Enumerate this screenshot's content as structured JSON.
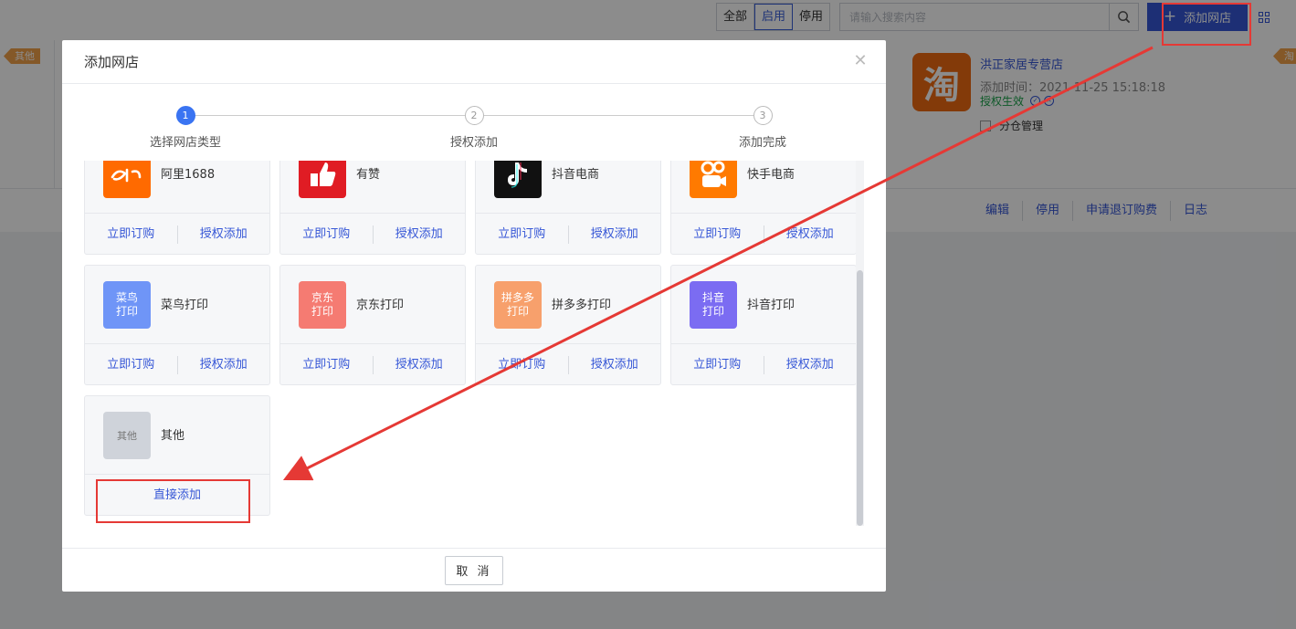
{
  "background": {
    "filters": [
      "全部",
      "启用",
      "停用"
    ],
    "active_filter": 1,
    "search_placeholder": "请输入搜索内容",
    "add_shop_label": "添加网店",
    "left_tag": "其他",
    "right_tag": "淘",
    "shop": {
      "logo_text": "淘",
      "name": "洪正家居专营店",
      "time": "添加时间：2021-11-25 15:18:18",
      "status": "授权生效",
      "checkbox_label": "分仓管理"
    },
    "actions": [
      "编辑",
      "停用",
      "申请退订购费",
      "日志"
    ]
  },
  "modal": {
    "title": "添加网店",
    "steps": [
      {
        "num": "1",
        "label": "选择网店类型"
      },
      {
        "num": "2",
        "label": "授权添加"
      },
      {
        "num": "3",
        "label": "添加完成"
      }
    ],
    "cards": [
      {
        "name": "阿里1688",
        "logo": "alibaba-1688-logo",
        "logo_text": "",
        "color": "#ff6a00",
        "actions": [
          "立即订购",
          "授权添加"
        ]
      },
      {
        "name": "有赞",
        "logo": "youzan-logo",
        "logo_text": "",
        "color": "#e01c24",
        "actions": [
          "立即订购",
          "授权添加"
        ]
      },
      {
        "name": "抖音电商",
        "logo": "douyin-logo",
        "logo_text": "",
        "color": "#111111",
        "actions": [
          "立即订购",
          "授权添加"
        ]
      },
      {
        "name": "快手电商",
        "logo": "kuaishou-logo",
        "logo_text": "",
        "color": "#ff7a00",
        "actions": [
          "立即订购",
          "授权添加"
        ]
      },
      {
        "name": "菜鸟打印",
        "logo": "cainiao-print-logo",
        "logo_text": "菜鸟\n打印",
        "color": "#6f95f7",
        "actions": [
          "立即订购",
          "授权添加"
        ]
      },
      {
        "name": "京东打印",
        "logo": "jd-print-logo",
        "logo_text": "京东\n打印",
        "color": "#f57b72",
        "actions": [
          "立即订购",
          "授权添加"
        ]
      },
      {
        "name": "拼多多打印",
        "logo": "pdd-print-logo",
        "logo_text": "拼多多\n打印",
        "color": "#f7a06c",
        "actions": [
          "立即订购",
          "授权添加"
        ]
      },
      {
        "name": "抖音打印",
        "logo": "douyin-print-logo",
        "logo_text": "抖音\n打印",
        "color": "#7b6cf2",
        "actions": [
          "立即订购",
          "授权添加"
        ]
      },
      {
        "name": "其他",
        "logo": "other-logo",
        "logo_text": "其他",
        "color": "#cfd3da",
        "actions": [
          "直接添加"
        ]
      }
    ],
    "cancel_label": "取 消"
  },
  "colors": {
    "primary": "#3556d6",
    "step_active": "#3a74f2",
    "annotation": "#e53935",
    "status_green": "#1aa34a"
  }
}
